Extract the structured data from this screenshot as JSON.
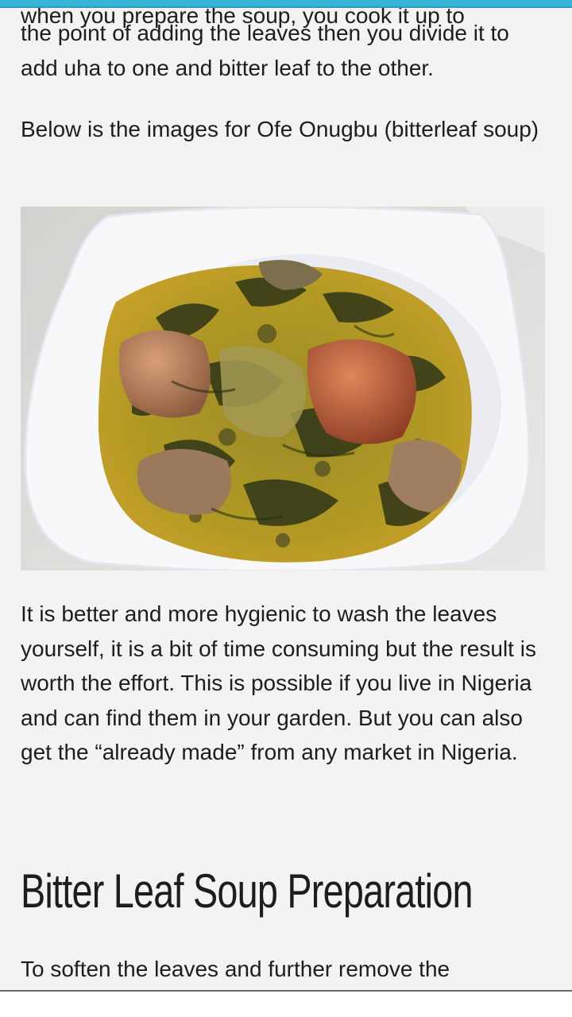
{
  "article": {
    "cut_line": "when you prepare the soup, you cook it up to",
    "paragraph_1": "the point of adding the leaves then you divide it to add uha to one and bitter leaf to the other.",
    "paragraph_2": "Below is the images for Ofe Onugbu (bitterleaf soup)",
    "paragraph_3": "It is better and more hygienic to wash the leaves yourself, it is a bit of time consuming but the result is worth the effort. This is possible if you live in Nigeria and can find them in your garden. But you can also get the “already made” from any market in Nigeria.",
    "heading": "Bitter Leaf Soup Preparation",
    "paragraph_4": "To soften the leaves and further remove the"
  },
  "colors": {
    "accent": "#35b6d8",
    "page_background": "#f3f3f1",
    "text": "#1d1d1d"
  }
}
